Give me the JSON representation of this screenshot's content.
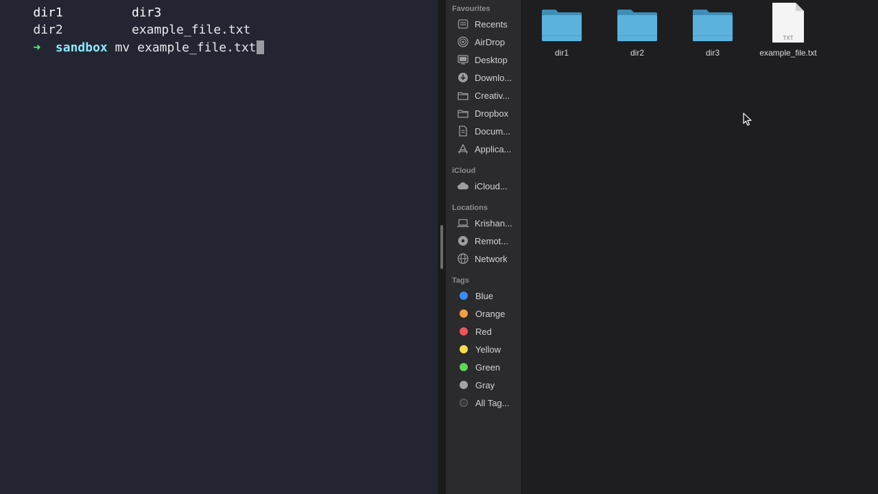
{
  "terminal": {
    "lines": [
      {
        "col1": "dir1",
        "col2": "dir3"
      },
      {
        "col1": "dir2",
        "col2": "example_file.txt"
      }
    ],
    "prompt": {
      "arrow": "➜",
      "directory": "sandbox",
      "command": "mv example_file.txt"
    }
  },
  "finder": {
    "sidebar": {
      "favourites_heading": "Favourites",
      "favourites": [
        {
          "label": "Recents",
          "icon": "clock-icon"
        },
        {
          "label": "AirDrop",
          "icon": "airdrop-icon"
        },
        {
          "label": "Desktop",
          "icon": "desktop-icon"
        },
        {
          "label": "Downlo...",
          "icon": "download-icon"
        },
        {
          "label": "Creativ...",
          "icon": "folder-icon"
        },
        {
          "label": "Dropbox",
          "icon": "folder-icon"
        },
        {
          "label": "Docum...",
          "icon": "document-icon"
        },
        {
          "label": "Applica...",
          "icon": "applications-icon"
        }
      ],
      "icloud_heading": "iCloud",
      "icloud": [
        {
          "label": "iCloud...",
          "icon": "cloud-icon"
        }
      ],
      "locations_heading": "Locations",
      "locations": [
        {
          "label": "Krishan...",
          "icon": "laptop-icon"
        },
        {
          "label": "Remot...",
          "icon": "disc-icon"
        },
        {
          "label": "Network",
          "icon": "globe-icon"
        }
      ],
      "tags_heading": "Tags",
      "tags": [
        {
          "label": "Blue",
          "color": "#3b8cf5"
        },
        {
          "label": "Orange",
          "color": "#f2a03d"
        },
        {
          "label": "Red",
          "color": "#f0545a"
        },
        {
          "label": "Yellow",
          "color": "#f5dc4b"
        },
        {
          "label": "Green",
          "color": "#5fd35a"
        },
        {
          "label": "Gray",
          "color": "#a3a3a6"
        },
        {
          "label": "All Tag...",
          "color": "all"
        }
      ]
    },
    "files": [
      {
        "name": "dir1",
        "type": "folder"
      },
      {
        "name": "dir2",
        "type": "folder"
      },
      {
        "name": "dir3",
        "type": "folder"
      },
      {
        "name": "example_file.txt",
        "type": "txt",
        "badge": "TXT"
      }
    ]
  }
}
